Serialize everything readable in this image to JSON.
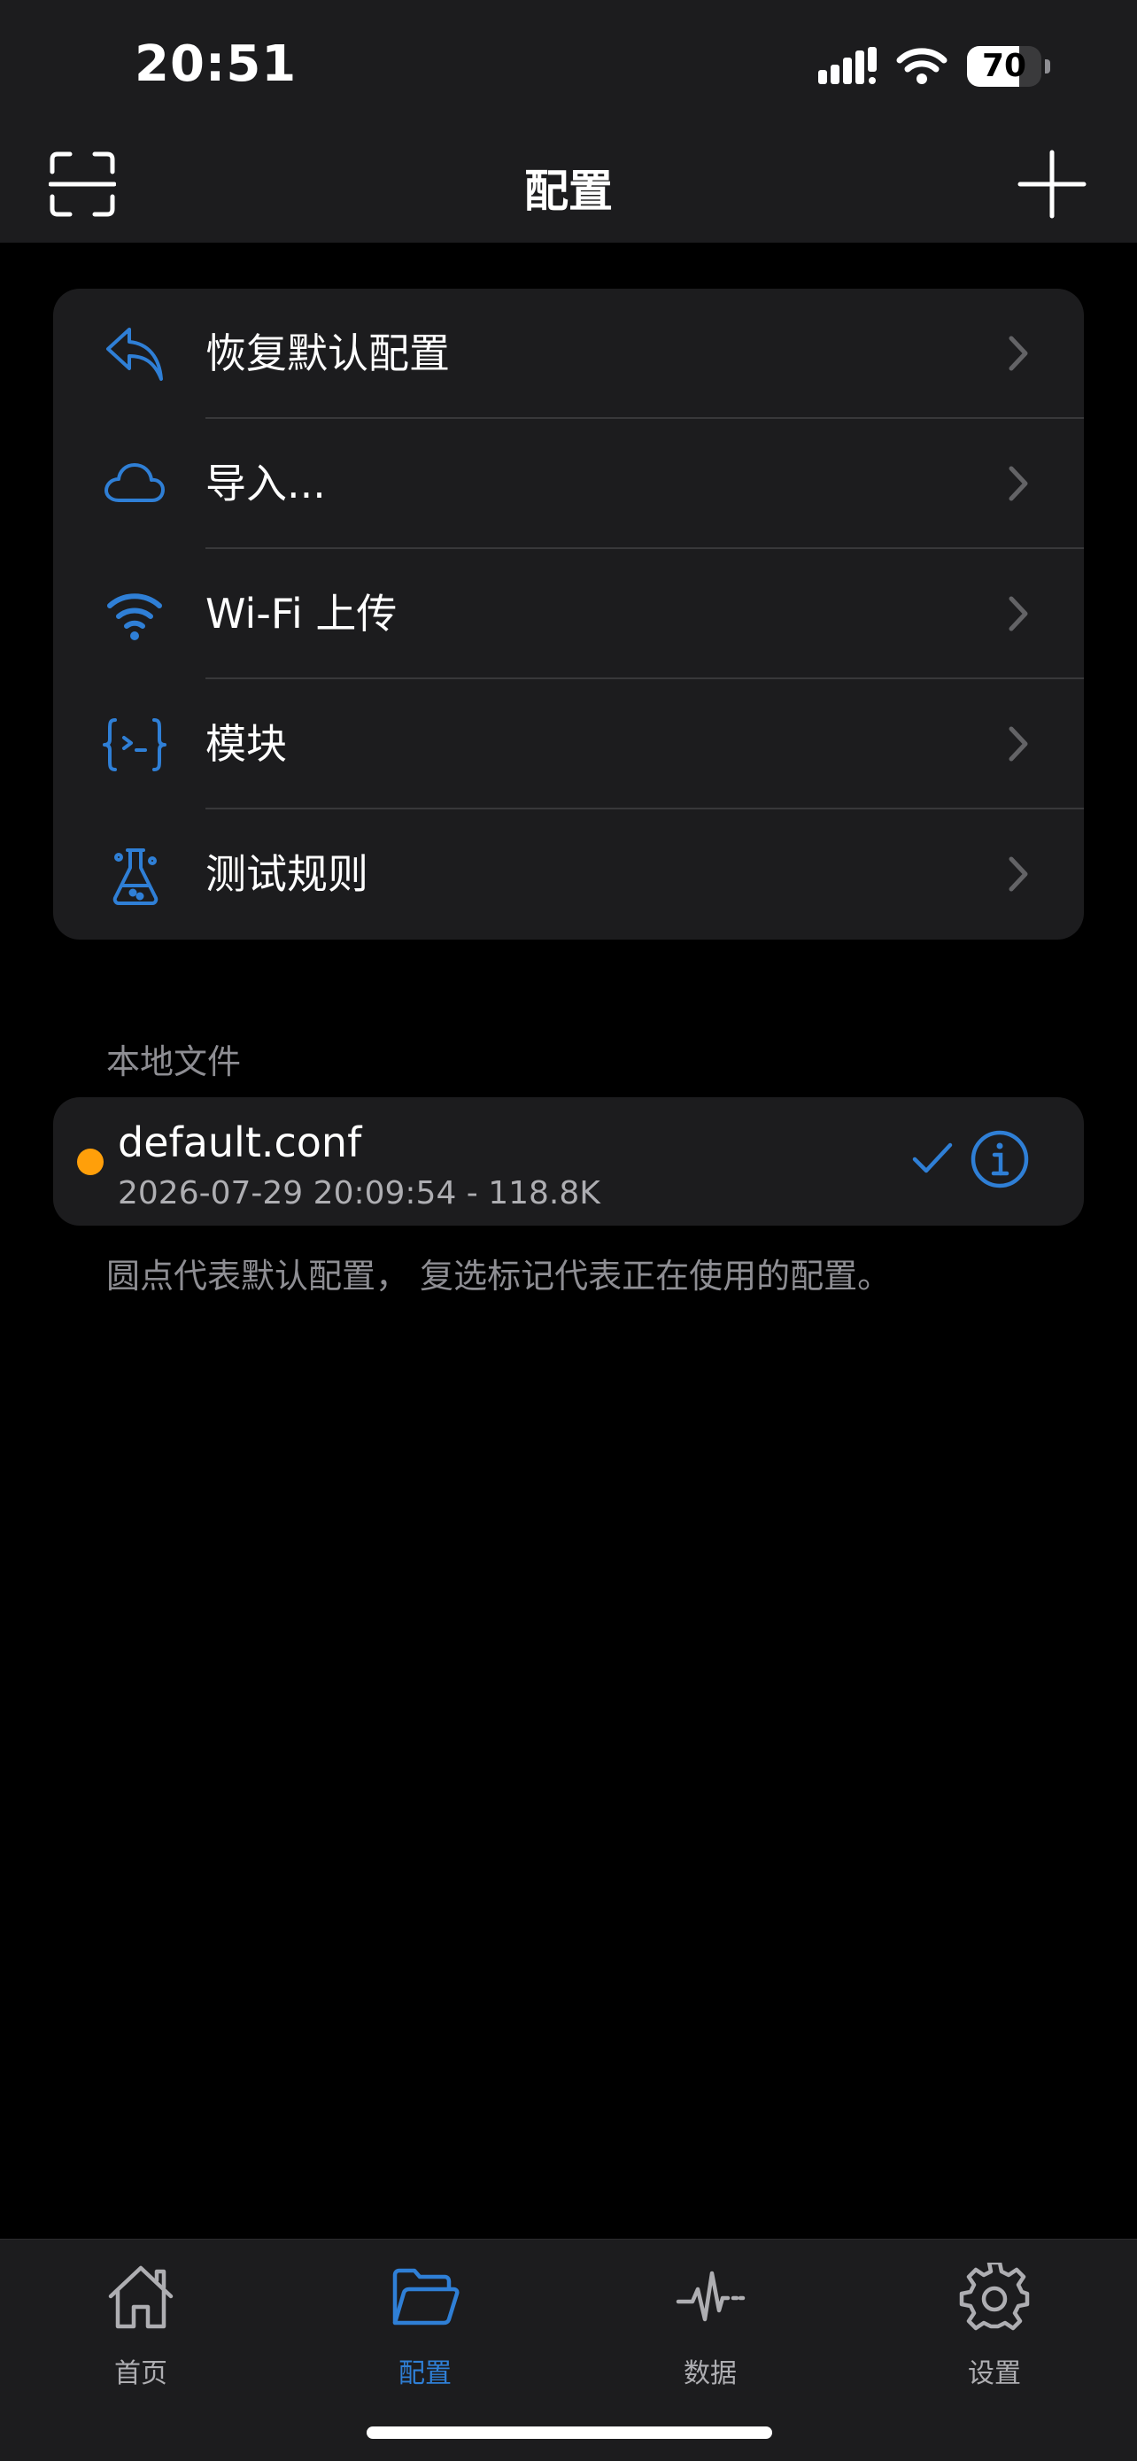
{
  "status_bar": {
    "time": "20:51",
    "battery": "70",
    "battery_level": 0.7
  },
  "nav": {
    "title": "配置",
    "left_icon": "scan-icon",
    "right_icon": "plus-icon"
  },
  "menu": {
    "items": [
      {
        "label": "恢复默认配置",
        "icon": "reply-icon"
      },
      {
        "label": "导入...",
        "icon": "cloud-icon"
      },
      {
        "label": "Wi-Fi 上传",
        "icon": "wifi-icon"
      },
      {
        "label": "模块",
        "icon": "curly-braces-icon"
      },
      {
        "label": "测试规则",
        "icon": "flask-icon"
      }
    ]
  },
  "local_files": {
    "header": "本地文件",
    "files": [
      {
        "name": "default.conf",
        "meta": "2026-07-29 20:09:54 - 118.8K"
      }
    ],
    "footer": "圆点代表默认配置， 复选标记代表正在使用的配置。"
  },
  "tabbar": {
    "tabs": [
      {
        "label": "首页",
        "icon": "house-icon"
      },
      {
        "label": "配置",
        "icon": "folder-icon",
        "active": true
      },
      {
        "label": "数据",
        "icon": "waveform-icon"
      },
      {
        "label": "设置",
        "icon": "gear-icon"
      }
    ]
  },
  "colors": {
    "accent": "#2f7fd6",
    "background": "#000000",
    "card": "#1c1c1e",
    "default_dot": "#ff9f0a",
    "secondary_text": "#8e8e93"
  }
}
